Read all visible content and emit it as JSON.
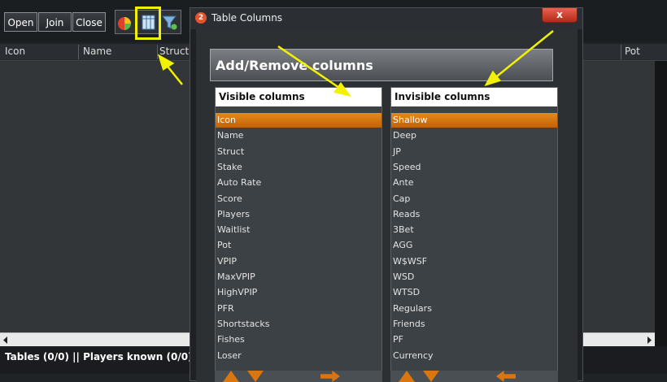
{
  "toolbar": {
    "open": "Open",
    "join": "Join",
    "close": "Close"
  },
  "grid": {
    "col_icon": "Icon",
    "col_name": "Name",
    "col_struct": "Struct",
    "col_pot": "Pot"
  },
  "status": {
    "text": "Tables (0/0) || Players known (0/0)"
  },
  "dialog": {
    "badge": "2",
    "title": "Table Columns",
    "close": "x",
    "heading": "Add/Remove columns",
    "visible_header": "Visible columns",
    "invisible_header": "Invisible columns",
    "visible_items": [
      "Icon",
      "Name",
      "Struct",
      "Stake",
      "Auto Rate",
      "Score",
      "Players",
      "Waitlist",
      "Pot",
      "VPIP",
      "MaxVPIP",
      "HighVPIP",
      "PFR",
      "Shortstacks",
      "Fishes",
      "Loser"
    ],
    "invisible_items": [
      "Shallow",
      "Deep",
      "JP",
      "Speed",
      "Ante",
      "Cap",
      "Reads",
      "3Bet",
      "AGG",
      "W$WSF",
      "WSD",
      "WTSD",
      "Regulars",
      "Friends",
      "PF",
      "Currency"
    ]
  },
  "colors": {
    "highlight": "#f2f200",
    "selection": "#d9760f",
    "close": "#c93a26"
  }
}
